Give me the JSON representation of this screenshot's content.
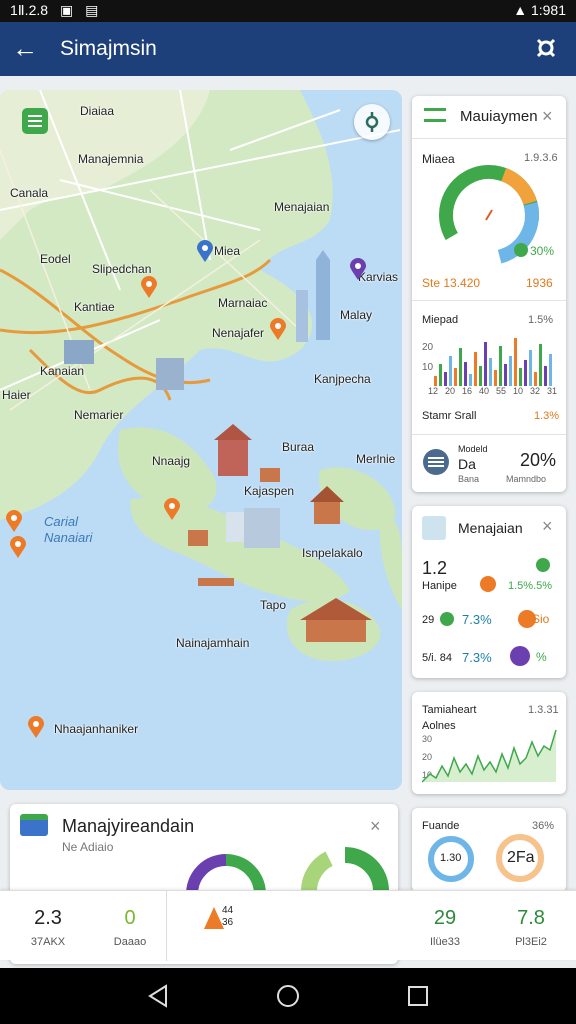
{
  "status_bar": {
    "time": "1Ⅱ.2.8",
    "right": "1:981"
  },
  "app_bar": {
    "title": "Simajmsin"
  },
  "map": {
    "labels": [
      "Diaiaa",
      "Manajemnia",
      "Canala",
      "Eodel",
      "Slipedchan",
      "Miea",
      "Menajaian",
      "Karvias",
      "Kantiae",
      "Marnaiac",
      "Nenajafer",
      "Malay",
      "Kanaian",
      "Haier",
      "Kanjpecha",
      "Nemarier",
      "Buraa",
      "Nnaajg",
      "Merlnie",
      "Kajaspen",
      "Tapo",
      "Isnpelakalo",
      "Nainajamhain",
      "Nhaajanhaniker"
    ],
    "water_label": "Carial\nNanaiari"
  },
  "panel_top": {
    "title": "Mauiaymen",
    "donut_label": "Miaea",
    "donut_value": "1.9.3.6",
    "donut_pct": "30%",
    "stat_left": "Ste 13.420",
    "stat_right": "1936",
    "bars_label": "Miepad",
    "bars_value": "1.5%",
    "bars_axis": [
      "20",
      "10"
    ],
    "bars_ticks": [
      "12",
      "20",
      "16",
      "40",
      "55",
      "10",
      "32",
      "31"
    ],
    "foot_left": "Stamr Srall",
    "foot_right": "1.3%",
    "model_title": "Modeld",
    "model_sub": "Da",
    "model_small": "Bana",
    "model_pct": "20%",
    "model_right": "Mamndbo"
  },
  "panel_mid": {
    "title": "Menajaian",
    "row1": {
      "left": "1.2",
      "sub": "Hanipe",
      "right": "1.5%.5%"
    },
    "row2": {
      "left": "29",
      "mid": "7.3%",
      "right": "Sio"
    },
    "row3": {
      "left": "5/i. 84",
      "mid": "7.3%",
      "right": "%"
    }
  },
  "panel_chart": {
    "title": "Tamiaheart",
    "value": "1.3.31",
    "sub": "Aolnes",
    "y_ticks": [
      "30",
      "20",
      "10"
    ]
  },
  "panel_bottom": {
    "title": "Fuande",
    "value": "36%",
    "ring_left": "1.30",
    "ring_right": "2Fa"
  },
  "bottom_card": {
    "title": "Manajyireandain",
    "subtitle": "Ne Adiaio"
  },
  "stats": [
    {
      "value": "2.3",
      "label": "37AKX"
    },
    {
      "value": "0",
      "label": "Daaao"
    },
    {
      "value": "44\n36",
      "label": ""
    },
    {
      "value": "29",
      "label": "Ilüe33"
    },
    {
      "value": "7.8",
      "label": "Pl3Ei2"
    }
  ],
  "colors": {
    "app_bar": "#1d3f7a",
    "green": "#3ea84b",
    "orange": "#f2a23a",
    "blue": "#6fb6e8",
    "purple": "#6a3fb0",
    "pin_orange": "#ec7a26"
  }
}
